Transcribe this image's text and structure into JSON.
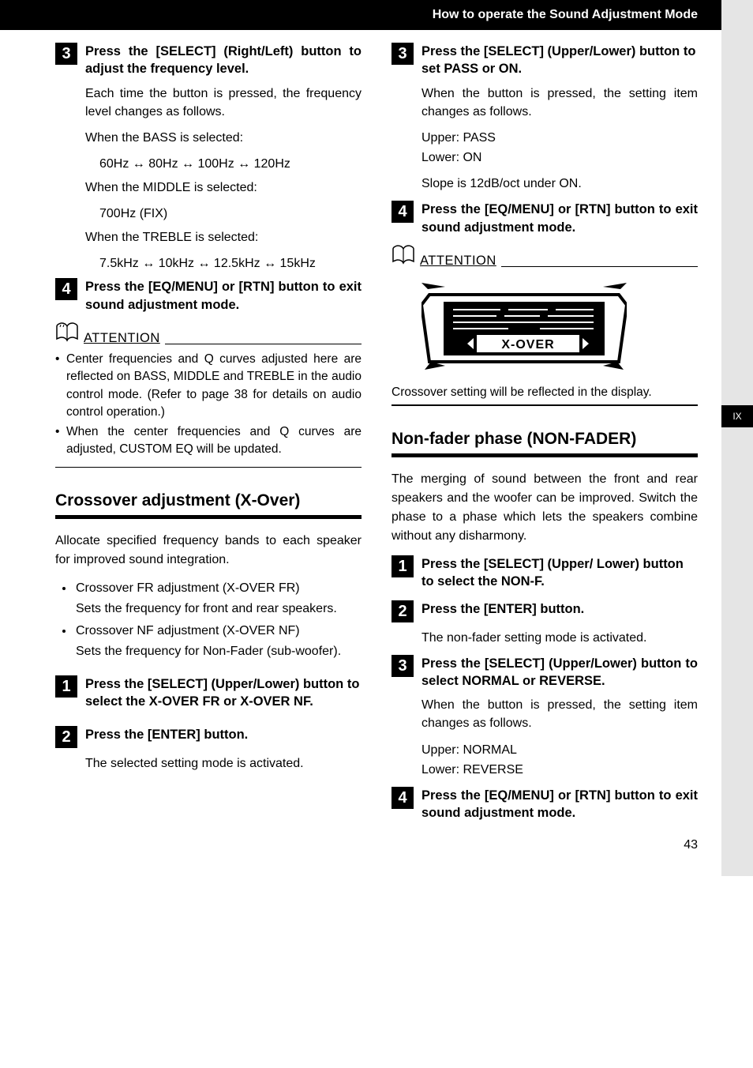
{
  "header": {
    "title": "How to operate the Sound Adjustment Mode"
  },
  "page_tab": "IX",
  "page_number": "43",
  "left": {
    "step3": {
      "num": "3",
      "title": "Press the [SELECT] (Right/Left) button to adjust the frequency level.",
      "body1": "Each time the button is pressed, the frequency level changes as follows.",
      "bass_label": "When the BASS is selected:",
      "bass_values": "60Hz ↔ 80Hz ↔ 100Hz ↔ 120Hz",
      "middle_label": "When the MIDDLE is selected:",
      "middle_values": "700Hz (FIX)",
      "treble_label": "When the TREBLE is selected:",
      "treble_values": "7.5kHz ↔ 10kHz ↔ 12.5kHz ↔ 15kHz"
    },
    "step4": {
      "num": "4",
      "title": "Press the [EQ/MENU] or [RTN] button to exit sound adjustment mode."
    },
    "attention": {
      "label": "ATTENTION",
      "items": [
        "Center frequencies and Q curves adjusted here are reflected on BASS, MIDDLE and TREBLE in the audio control mode. (Refer to page 38 for details on audio control operation.)",
        "When the center frequencies and Q curves are adjusted, CUSTOM EQ will be updated."
      ]
    },
    "xover": {
      "title": "Crossover adjustment (X-Over)",
      "desc": "Allocate specified frequency bands to each speaker for improved sound integration.",
      "items": [
        {
          "head": "Crossover FR adjustment (X-OVER FR)",
          "sub": "Sets the frequency for front and rear speakers."
        },
        {
          "head": "Crossover NF adjustment (X-OVER NF)",
          "sub": "Sets the frequency for Non-Fader (sub-woofer)."
        }
      ],
      "step1": {
        "num": "1",
        "title": "Press the [SELECT] (Upper/Lower) button to select the X-OVER FR or X-OVER NF."
      },
      "step2": {
        "num": "2",
        "title": "Press the [ENTER] button.",
        "body": "The selected setting mode is activated."
      }
    }
  },
  "right": {
    "step3": {
      "num": "3",
      "title": "Press the [SELECT] (Upper/Lower) button to set PASS or ON.",
      "body1": "When the button is pressed, the setting item changes as follows.",
      "upper": "Upper: PASS",
      "lower": "Lower: ON",
      "slope": "Slope is 12dB/oct under ON."
    },
    "step4": {
      "num": "4",
      "title": "Press the [EQ/MENU] or [RTN] button to exit sound adjustment mode."
    },
    "attention": {
      "label": "ATTENTION",
      "fig_text": "X-OVER",
      "caption": "Crossover setting will be reflected in the display."
    },
    "nonfader": {
      "title": "Non-fader phase (NON-FADER)",
      "desc": "The merging of sound between the front and rear speakers and the woofer can be improved. Switch the phase to a phase which lets the speakers combine without any disharmony.",
      "step1": {
        "num": "1",
        "title": "Press the [SELECT] (Upper/ Lower) button to select the NON-F."
      },
      "step2": {
        "num": "2",
        "title": "Press the [ENTER] button.",
        "body": "The non-fader setting mode is activated."
      },
      "step3": {
        "num": "3",
        "title": "Press the [SELECT] (Upper/Lower) button to select NORMAL or REVERSE.",
        "body1": "When the button is pressed, the setting item changes as follows.",
        "upper": "Upper: NORMAL",
        "lower": "Lower: REVERSE"
      },
      "step4": {
        "num": "4",
        "title": "Press the [EQ/MENU] or [RTN] button to exit sound adjustment mode."
      }
    }
  }
}
